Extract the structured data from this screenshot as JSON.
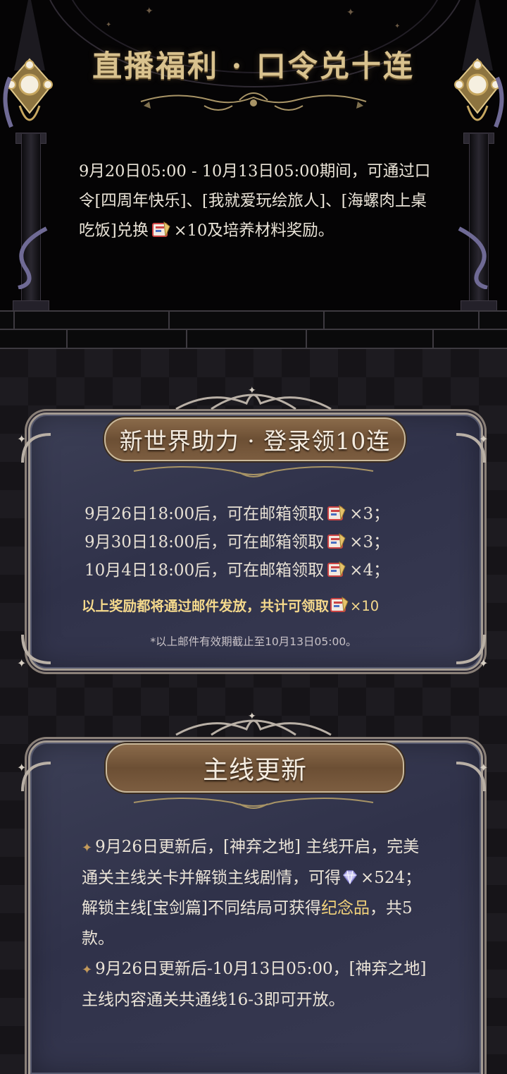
{
  "section_live": {
    "title": "直播福利 · 口令兑十连",
    "intro_before": "9月20日05:00 - 10月13日05:00期间，可通过口令[四周年快乐]、[我就爱玩绘旅人]、[海螺肉上桌吃饭]兑换",
    "intro_mult": "×10",
    "intro_after": "及培养材料奖励。"
  },
  "section_login": {
    "title": "新世界助力 · 登录领10连",
    "rewards": [
      {
        "text": "9月26日18:00后，可在邮箱领取",
        "mult": "×3；"
      },
      {
        "text": "9月30日18:00后，可在邮箱领取",
        "mult": "×3；"
      },
      {
        "text": "10月4日18:00后，可在邮箱领取",
        "mult": "×4；"
      }
    ],
    "summary_text": "以上奖励都将通过邮件发放，共计可领取",
    "summary_mult": "×10",
    "note": "*以上邮件有效期截止至10月13日05:00。"
  },
  "section_main": {
    "title": "主线更新",
    "bullet_icon": "four-point-star-icon",
    "p1_a": "9月26日更新后，[神弃之地] 主线开启，完美通关主线关卡并解锁主线剧情，可得",
    "p1_gem_mult": "×524",
    "p1_b": "；解锁主线[宝剑篇]不同结局可获得",
    "p1_highlight": "纪念品",
    "p1_c": "，共5款。",
    "p2": "9月26日更新后-10月13日05:00，[神弃之地]主线内容通关共通线16-3即可开放。"
  },
  "colors": {
    "title_gold": "#d9c28e",
    "summary_yellow": "#f5d98c",
    "highlight": "#f2d27a",
    "panel_blue": "#34374f",
    "banner_brown": "#7a5b3e"
  }
}
